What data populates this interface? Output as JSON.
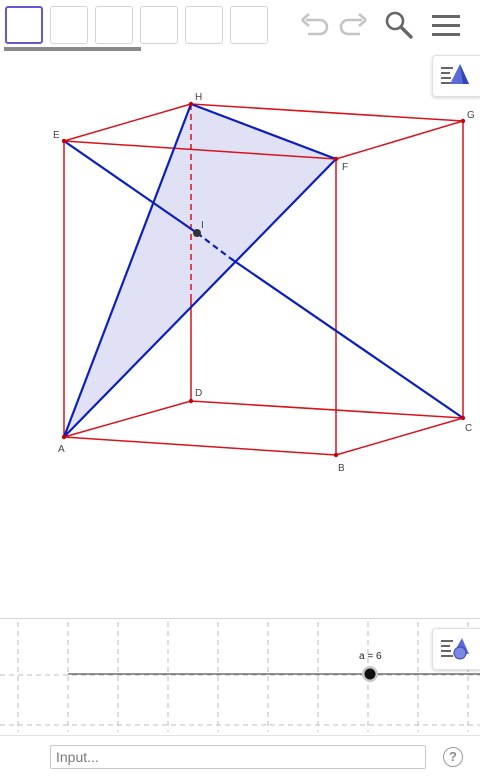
{
  "toolbar": {
    "tool_buttons": [
      "tool-move",
      "tool-point",
      "tool-line",
      "tool-polygon",
      "tool-sphere",
      "tool-solid"
    ],
    "undo_icon": "undo-icon",
    "redo_icon": "redo-icon",
    "search_icon": "search-icon",
    "menu_icon": "hamburger-menu-icon"
  },
  "view3d": {
    "menu_icon": "3d-view-style-icon",
    "points": {
      "A": "A",
      "B": "B",
      "C": "C",
      "D": "D",
      "E": "E",
      "F": "F",
      "G": "G",
      "H": "H",
      "I": "I"
    },
    "colors": {
      "edges": "#d8131b",
      "diagonals": "#0b1fbf",
      "face_fill": "#dcdcf4",
      "point": "#c80000"
    }
  },
  "view2d": {
    "menu_icon": "graphics-style-icon",
    "slider_label": "a = 6",
    "slider_value": 6
  },
  "input_bar": {
    "placeholder": "Input...",
    "help": "?"
  }
}
